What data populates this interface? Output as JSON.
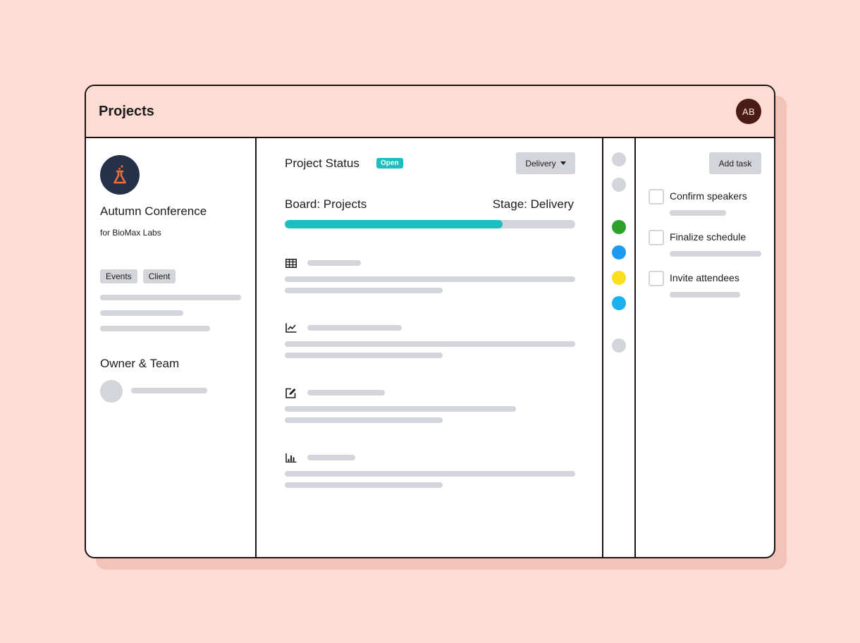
{
  "header": {
    "title": "Projects",
    "user_initials": "AB"
  },
  "project": {
    "icon": "flask-icon",
    "name": "Autumn Conference",
    "client": "for BioMax Labs",
    "tags": [
      "Events",
      "Client"
    ],
    "team_section_title": "Owner & Team"
  },
  "status": {
    "title": "Project Status",
    "badge": "Open",
    "dropdown_value": "Delivery",
    "board_label": "Board: Projects",
    "stage_label": "Stage: Delivery",
    "progress": 0.75,
    "sections": [
      {
        "icon": "table-icon"
      },
      {
        "icon": "line-chart-icon"
      },
      {
        "icon": "edit-icon"
      },
      {
        "icon": "bar-chart-icon"
      }
    ]
  },
  "timeline_dots": [
    {
      "color": "#d3d5db"
    },
    {
      "color": "#d3d5db"
    },
    {
      "color": "#2ea12a"
    },
    {
      "color": "#1e9af0"
    },
    {
      "color": "#fbdf1f"
    },
    {
      "color": "#1bb1ef"
    },
    {
      "color": "#d3d5db"
    }
  ],
  "tasks": {
    "add_label": "Add task",
    "items": [
      {
        "label": "Confirm speakers",
        "checked": false
      },
      {
        "label": "Finalize schedule",
        "checked": false
      },
      {
        "label": "Invite attendees",
        "checked": false
      }
    ]
  }
}
